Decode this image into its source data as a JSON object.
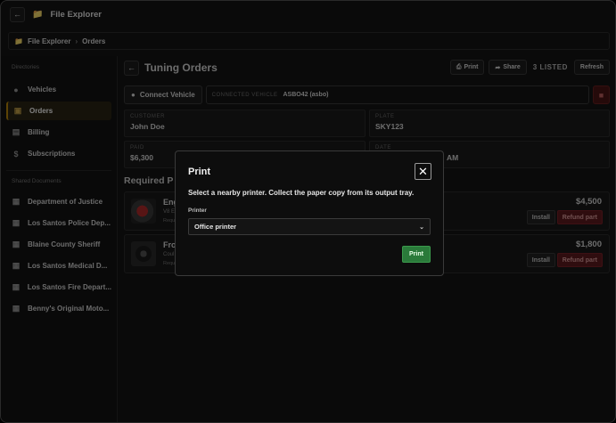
{
  "window": {
    "title": "File Explorer"
  },
  "breadcrumb": {
    "root": "File Explorer",
    "current": "Orders"
  },
  "sidebar": {
    "directories_label": "Directories",
    "items": [
      {
        "label": "Vehicles",
        "icon": "car-icon"
      },
      {
        "label": "Orders",
        "icon": "box-icon",
        "active": true
      },
      {
        "label": "Billing",
        "icon": "receipt-icon"
      },
      {
        "label": "Subscriptions",
        "icon": "dollar-icon"
      }
    ],
    "shared_label": "Shared Documents",
    "shared": [
      {
        "label": "Department of Justice"
      },
      {
        "label": "Los Santos Police Dep..."
      },
      {
        "label": "Blaine County Sheriff"
      },
      {
        "label": "Los Santos Medical D..."
      },
      {
        "label": "Los Santos Fire Depart..."
      },
      {
        "label": "Benny's Original Moto..."
      }
    ]
  },
  "main": {
    "title": "Tuning Orders",
    "print_label": "Print",
    "share_label": "Share",
    "listed": "3 LISTED",
    "refresh_label": "Refresh",
    "connect_label": "Connect Vehicle",
    "connected_vehicle_label": "CONNECTED VEHICLE",
    "connected_vehicle_value": "ASBO42 (asbo)",
    "customer_label": "CUSTOMER",
    "customer_value": "John Doe",
    "plate_label": "PLATE",
    "plate_value": "SKY123",
    "paid_label": "PAID",
    "paid_value": "$6,300",
    "date_label": "DATE",
    "date_value": "AM",
    "required_title": "Required P",
    "parts": [
      {
        "name": "Eng",
        "sub": "V8 E",
        "sub2": "Requ",
        "price": "$4,500",
        "install": "Install",
        "refund": "Refund part"
      },
      {
        "name": "Fro",
        "sub": "Coul",
        "sub2": "Requ",
        "price": "$1,800",
        "install": "Install",
        "refund": "Refund part"
      }
    ]
  },
  "modal": {
    "title": "Print",
    "description": "Select a nearby printer. Collect the paper copy from its output tray.",
    "printer_label": "Printer",
    "printer_selected": "Office printer",
    "print_button": "Print"
  },
  "colors": {
    "accent": "#b8860b",
    "danger": "#5e1a1e",
    "success": "#2a7a3a"
  }
}
